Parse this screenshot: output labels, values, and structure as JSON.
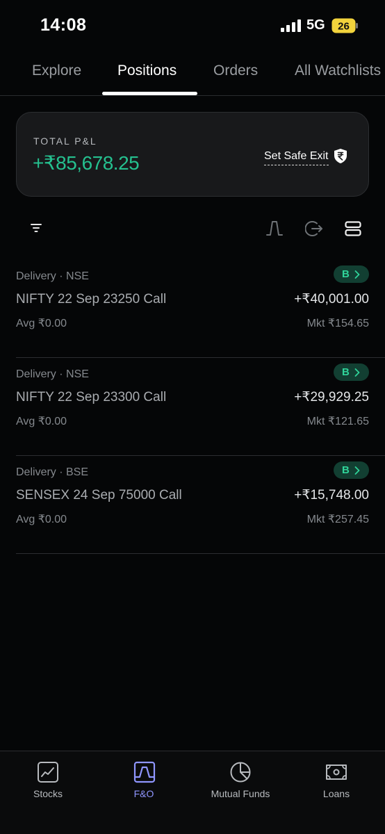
{
  "status_bar": {
    "time": "14:08",
    "network": "5G",
    "battery": "26"
  },
  "tabs": [
    {
      "label": "Explore",
      "active": false
    },
    {
      "label": "Positions",
      "active": true
    },
    {
      "label": "Orders",
      "active": false
    },
    {
      "label": "All Watchlists",
      "active": false
    }
  ],
  "pnl_card": {
    "label": "TOTAL P&L",
    "value": "+₹85,678.25",
    "safe_exit_label": "Set Safe Exit",
    "value_color": "#25c08f"
  },
  "toolbar": {
    "filter_icon": "filter-icon",
    "icons": [
      "strategy-icon",
      "exit-all-icon",
      "view-toggle-icon"
    ]
  },
  "positions": [
    {
      "segment": "Delivery · NSE",
      "name": "NIFTY 22 Sep 23250 Call",
      "avg": "Avg ₹0.00",
      "badge": "B",
      "pnl": "+₹40,001.00",
      "mkt": "Mkt ₹154.65"
    },
    {
      "segment": "Delivery · NSE",
      "name": "NIFTY 22 Sep 23300 Call",
      "avg": "Avg ₹0.00",
      "badge": "B",
      "pnl": "+₹29,929.25",
      "mkt": "Mkt ₹121.65"
    },
    {
      "segment": "Delivery · BSE",
      "name": "SENSEX 24 Sep 75000 Call",
      "avg": "Avg ₹0.00",
      "badge": "B",
      "pnl": "+₹15,748.00",
      "mkt": "Mkt ₹257.45"
    }
  ],
  "bottom_nav": [
    {
      "label": "Stocks",
      "icon": "stocks-chart-icon",
      "active": false
    },
    {
      "label": "F&O",
      "icon": "fno-chart-icon",
      "active": true
    },
    {
      "label": "Mutual Funds",
      "icon": "pie-chart-icon",
      "active": false
    },
    {
      "label": "Loans",
      "icon": "loan-note-icon",
      "active": false
    }
  ],
  "colors": {
    "background": "#050607",
    "profit_green": "#25c08f",
    "badge_bg": "#123f32",
    "active_nav": "#8f96ff"
  }
}
